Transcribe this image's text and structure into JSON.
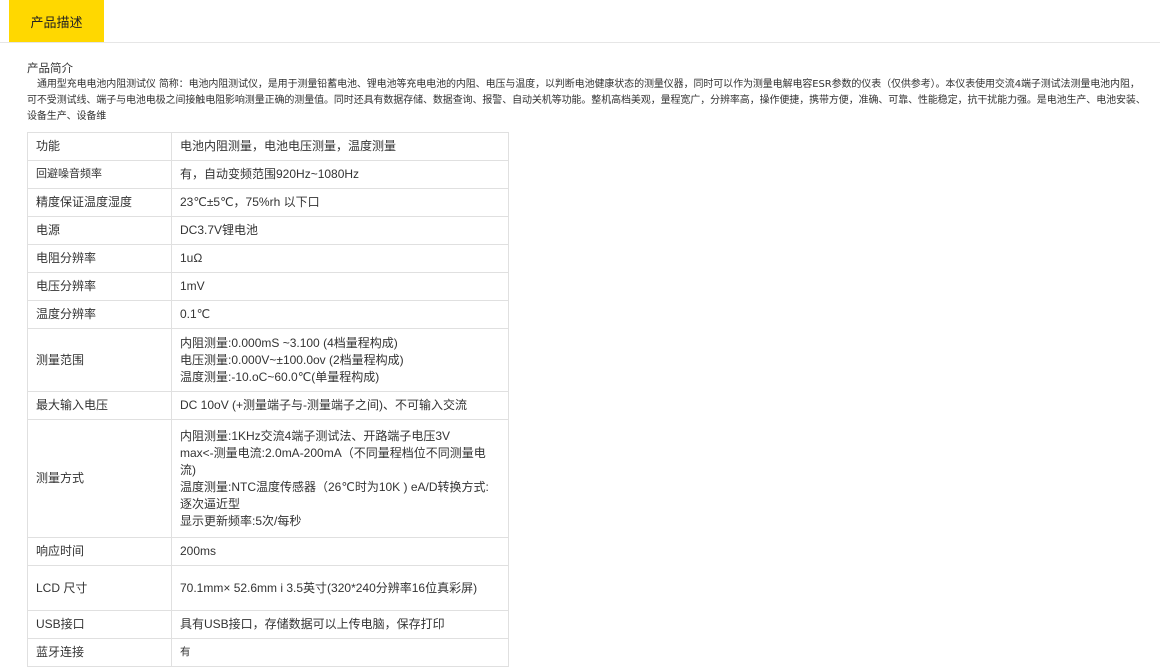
{
  "tabs": {
    "active_label": "产品描述"
  },
  "intro": {
    "title": "产品简介",
    "text": "通用型充电电池内阻测试仪 简称：电池内阻测试仪，是用于测量铅蓄电池、锂电池等充电电池的内阻、电压与温度，以判断电池健康状态的测量仪器，同时可以作为测量电解电容ESR参数的仪表（仅供参考）。本仪表使用交流4端子测试法测量电池内阻，可不受测试线、端子与电池电极之间接触电阻影响测量正确的测量值。同时还具有数据存储、数据查询、报警、自动关机等功能。整机高档美观，量程宽广，分辨率高，操作便捷，携带方便，准确、可靠、性能稳定，抗干扰能力强。是电池生产、电池安装、设备生产、设备维"
  },
  "specs": {
    "rows": [
      {
        "key": "功能",
        "lines": [
          " 电池内阻测量，电池电压测量，温度测量"
        ]
      },
      {
        "key": "回避噪音频率",
        "lines": [
          "有，自动变频范围920Hz~1080Hz"
        ]
      },
      {
        "key": "精度保证温度湿度",
        "lines": [
          "23℃±5℃，75%rh 以下口"
        ]
      },
      {
        "key": "电源",
        "lines": [
          "DC3.7V锂电池"
        ]
      },
      {
        "key": "电阻分辨率",
        "lines": [
          "1uΩ"
        ]
      },
      {
        "key": "电压分辨率",
        "lines": [
          "1mV"
        ]
      },
      {
        "key": "温度分辨率",
        "lines": [
          "0.1℃"
        ]
      },
      {
        "key": "测量范围",
        "lines": [
          " 内阻测量:0.000mS ~3.100 (4档量程构成)",
          "电压测量:0.000V~±100.0ov (2档量程构成)",
          "温度测量:-10.oC~60.0℃(单量程构成)"
        ]
      },
      {
        "key": "最大输入电压",
        "lines": [
          "DC 10oV (+测量端子与-测量端子之间)、不可输入交流"
        ]
      },
      {
        "key": "测量方式",
        "lines": [
          "内阻测量:1KHz交流4端子测试法、开路端子电压3V",
          "max<-测量电流:2.0mA-200mA（不同量程档位不同测量电流)",
          "温度测量:NTC温度传感器（26℃时为10K ) eA/D转换方式:逐次逼近型",
          "显示更新频率:5次/每秒"
        ]
      },
      {
        "key": "响应时间",
        "lines": [
          "200ms"
        ]
      },
      {
        "key": "LCD 尺寸",
        "lines": [
          "70.1mm× 52.6mm i 3.5英寸(320*240分辨率16位真彩屏)"
        ]
      },
      {
        "key": "USB接口",
        "lines": [
          "具有USB接口，存储数据可以上传电脑，保存打印"
        ]
      },
      {
        "key": "蓝牙连接",
        "lines": [
          "有"
        ]
      }
    ]
  }
}
